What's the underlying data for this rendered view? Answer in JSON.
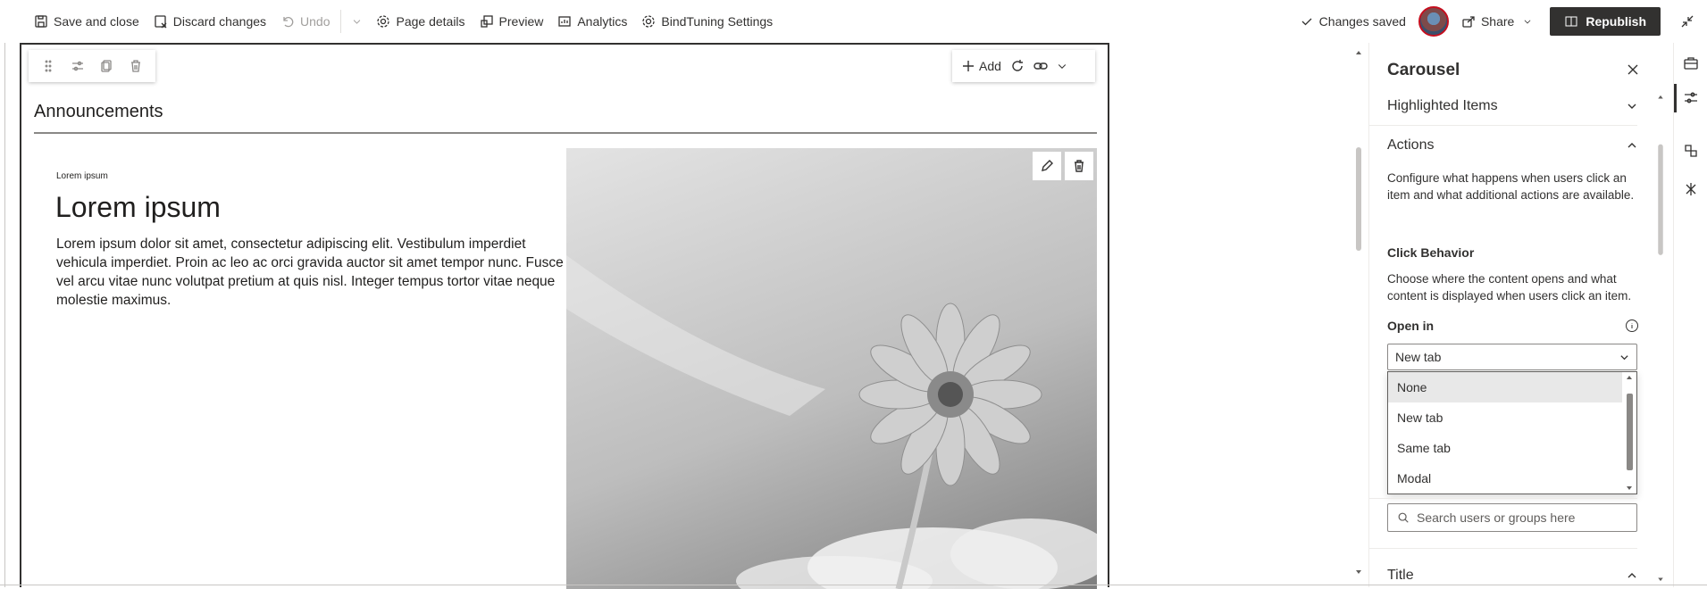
{
  "toolbar": {
    "save_close": "Save and close",
    "discard": "Discard changes",
    "undo": "Undo",
    "page_details": "Page details",
    "preview": "Preview",
    "analytics": "Analytics",
    "bindtuning": "BindTuning Settings",
    "changes_saved": "Changes saved",
    "share": "Share",
    "republish": "Republish"
  },
  "webpart": {
    "add_label": "Add",
    "title": "Announcements",
    "slide": {
      "kicker": "Lorem ipsum",
      "heading": "Lorem ipsum",
      "body": "Lorem ipsum dolor sit amet, consectetur adipiscing elit. Vestibulum imperdiet vehicula imperdiet. Proin ac leo ac orci gravida auctor sit amet tempor nunc. Fusce vel arcu vitae nunc volutpat pretium at quis nisl. Integer tempus tortor vitae neque molestie maximus."
    }
  },
  "panel": {
    "title": "Carousel",
    "highlighted": "Highlighted Items",
    "actions": "Actions",
    "actions_desc": "Configure what happens when users click an item and what additional actions are available.",
    "click_behavior": "Click Behavior",
    "click_desc": "Choose where the content opens and what content is displayed when users click an item.",
    "open_in_label": "Open in",
    "open_in_value": "New tab",
    "options": [
      "None",
      "New tab",
      "Same tab",
      "Modal"
    ],
    "search_placeholder": "Search users or groups here",
    "title_section": "Title"
  },
  "colors": {
    "accent_dark": "#323130",
    "avatar_ring": "#c50f1f"
  }
}
